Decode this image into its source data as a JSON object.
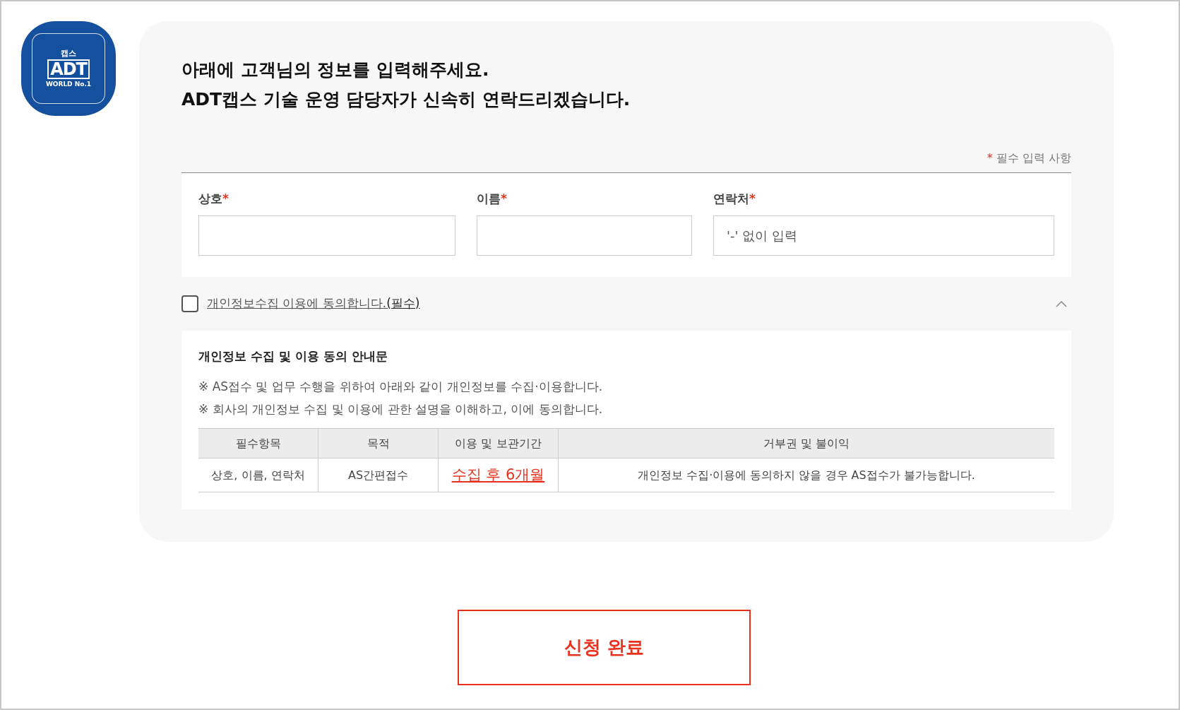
{
  "logo": {
    "top": "캡스",
    "brand": "ADT",
    "bottom": "WORLD No.1"
  },
  "heading": [
    "아래에 고객님의 정보를 입력해주세요.",
    "ADT캡스 기술 운영 담당자가 신속히 연락드리겠습니다."
  ],
  "required_note": {
    "mark": "*",
    "text": "필수 입력 사항"
  },
  "fields": [
    {
      "label": "상호",
      "mark": "*"
    },
    {
      "label": "이름",
      "mark": "*"
    },
    {
      "label": "연락처",
      "mark": "*",
      "placeholder": "'-' 없이 입력"
    }
  ],
  "consent": {
    "checked": false,
    "link": "개인정보수집 이용에 동의합니다.",
    "suffix": "(필수)",
    "expanded": true
  },
  "notice": {
    "title": "개인정보 수집 및 이용 동의 안내문",
    "lines": [
      "※ AS접수 및 업무 수행을 위하여 아래와 같이 개인정보를 수집·이용합니다.",
      "※ 회사의 개인정보 수집 및 이용에 관한 설명을 이해하고, 이에 동의합니다."
    ],
    "table": {
      "columns": [
        "필수항목",
        "목적",
        "이용 및 보관기간",
        "거부권 및 불이익"
      ],
      "rows": [
        [
          {
            "text": "상호, 이름, 연락처",
            "kind": "plain"
          },
          {
            "text": "AS간편접수",
            "kind": "plain"
          },
          {
            "text": "수집 후 6개월",
            "kind": "emphasis"
          },
          {
            "text": "개인정보 수집·이용에 동의하지 않을 경우 AS접수가 불가능합니다.",
            "kind": "plain"
          }
        ]
      ]
    }
  },
  "submit": "신청 완료"
}
